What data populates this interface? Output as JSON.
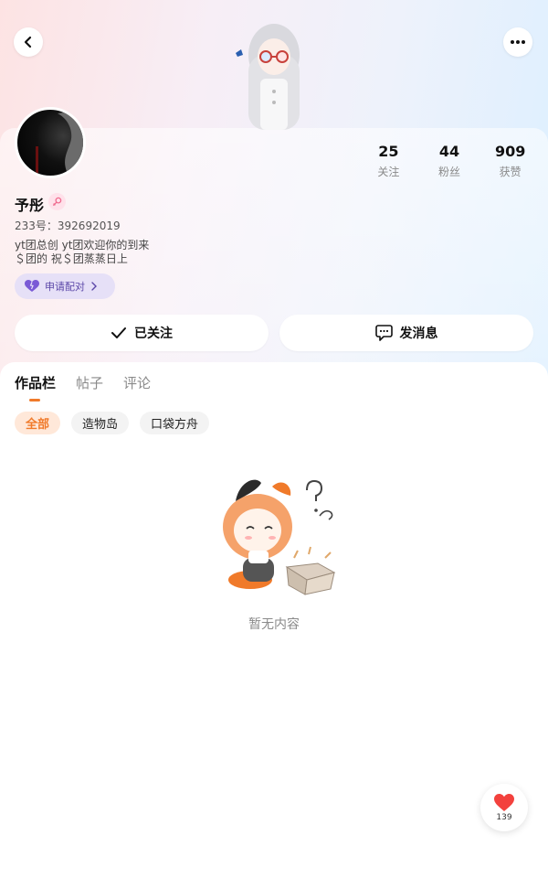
{
  "profile": {
    "name": "予彤",
    "uid": "233号：392692019",
    "bio_lines": [
      "yt团总创 yt团欢迎你的到来",
      "＄团的 祝＄团蒸蒸日上"
    ],
    "stats": [
      {
        "value": "25",
        "label": "关注"
      },
      {
        "value": "44",
        "label": "粉丝"
      },
      {
        "value": "909",
        "label": "获赞"
      }
    ],
    "pair_label": "申请配对"
  },
  "actions": {
    "follow_label": "已关注",
    "message_label": "发消息"
  },
  "tabs": [
    {
      "label": "作品栏",
      "active": true
    },
    {
      "label": "帖子",
      "active": false
    },
    {
      "label": "评论",
      "active": false
    }
  ],
  "filters": [
    {
      "label": "全部",
      "active": true
    },
    {
      "label": "造物岛",
      "active": false
    },
    {
      "label": "口袋方舟",
      "active": false
    }
  ],
  "empty": {
    "text": "暂无内容"
  },
  "like_fab": {
    "count": "139"
  },
  "colors": {
    "accent": "#f07a2a",
    "pair": "#5b47a8",
    "heart": "#f3413d"
  },
  "icons": [
    "back-icon",
    "more-icon",
    "female-icon",
    "heart-pair-icon",
    "chevron-right-icon",
    "check-icon",
    "chat-icon",
    "heart-icon"
  ]
}
